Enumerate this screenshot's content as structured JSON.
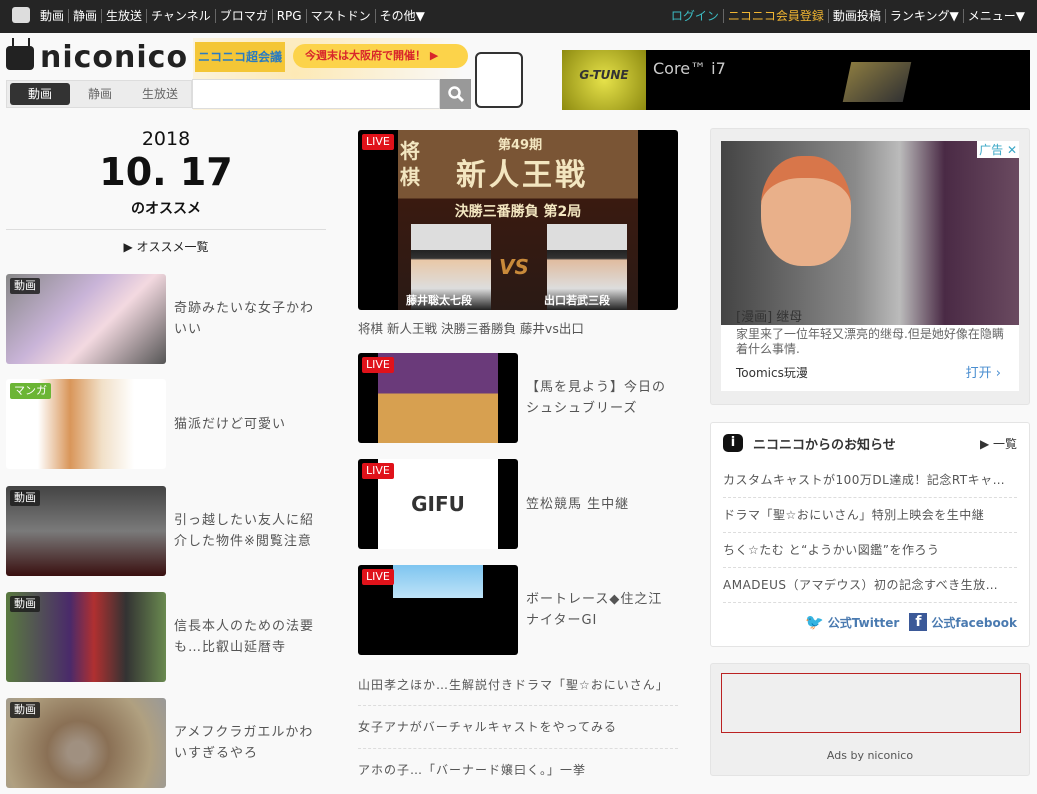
{
  "topbar": {
    "left": [
      "動画",
      "静画",
      "生放送",
      "チャンネル",
      "ブロマガ",
      "RPG",
      "マストドン",
      "その他▼"
    ],
    "login": "ログイン",
    "register": "ニコニコ会員登録",
    "upload": "動画投稿",
    "ranking": "ランキング▼",
    "menu": "メニュー▼",
    "colors": {
      "login": "#3cbcc3",
      "register": "#f2b632"
    }
  },
  "header": {
    "logo": "niconico",
    "banner": {
      "left": "ニコニコ超会議",
      "text": "今週末は大阪府で開催！ ▶"
    },
    "search_tabs": [
      "動画",
      "静画",
      "生放送"
    ],
    "search_value": "",
    "ad": {
      "brand": "G-TUNE",
      "text": "Core™ i7"
    }
  },
  "recommend": {
    "year": "2018",
    "date": "10. 17",
    "suffix": "のオススメ",
    "list_link": "▶ オススメ一覧",
    "items": [
      {
        "badge": "動画",
        "title": "奇跡みたいな女子かわいい"
      },
      {
        "badge": "マンガ",
        "title": "猫派だけど可愛い"
      },
      {
        "badge": "動画",
        "title": "引っ越したい友人に紹介した物件※閲覧注意"
      },
      {
        "badge": "動画",
        "title": "信長本人のための法要も…比叡山延暦寺"
      },
      {
        "badge": "動画",
        "title": "アメフクラガエルかわいすぎるやろ"
      }
    ]
  },
  "live": {
    "main": {
      "badge": "LIVE",
      "title": "将棋 新人王戦 決勝三番勝負 藤井vs出口",
      "image_text": {
        "top": "第49期",
        "big": "新人王戦",
        "side": "将棋",
        "sub": "決勝三番勝負 第2局",
        "p1": "藤井聡太七段",
        "p2": "出口若武三段",
        "vs": "VS"
      }
    },
    "items": [
      {
        "badge": "LIVE",
        "title": "【馬を見よう】今日のシュシュブリーズ"
      },
      {
        "badge": "LIVE",
        "title": "笠松競馬 生中継"
      },
      {
        "badge": "LIVE",
        "title": "ボートレース◆住之江ナイターGI"
      }
    ],
    "text_items": [
      "山田孝之ほか…生解説付きドラマ「聖☆おにいさん」",
      "女子アナがバーチャルキャストをやってみる",
      "アホの子…「バーナード嬢曰く。」一挙"
    ]
  },
  "ad_side": {
    "label": "广告",
    "close": "✕",
    "title": "[漫画] 继母",
    "desc": "家里来了一位年轻又漂亮的继母.但是她好像在隐瞒着什么事情.",
    "advertiser": "Toomics玩漫",
    "cta": "打开 ›"
  },
  "notices": {
    "title": "ニコニコからのお知らせ",
    "more": "▶ 一覧",
    "items": [
      "カスタムキャストが100万DL達成！記念RTキャ…",
      "ドラマ「聖☆おにいさん」特別上映会を生中継",
      "ちく☆たむ と“ようかい図鑑”を作ろう",
      "AMADEUS（アマデウス）初の記念すべき生放…"
    ],
    "twitter": "公式Twitter",
    "facebook": "公式facebook"
  },
  "ads_footer": "Ads by niconico"
}
